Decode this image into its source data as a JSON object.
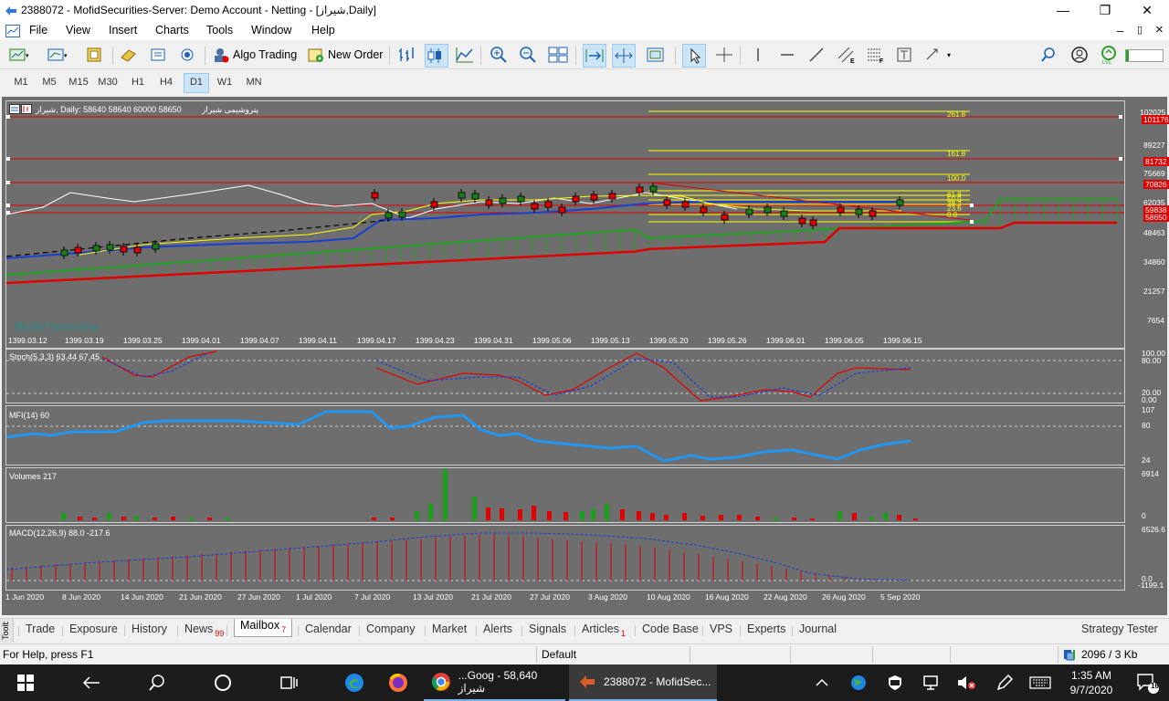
{
  "window": {
    "title": "2388072 - MofidSecurities-Server: Demo Account - Netting - [شیراز,Daily]",
    "min_btn": "—",
    "max_btn": "❐",
    "close_btn": "✕",
    "restore_btn": "▯",
    "child_min": "–",
    "child_close": "×"
  },
  "menu": [
    "File",
    "View",
    "Insert",
    "Charts",
    "Tools",
    "Window",
    "Help"
  ],
  "toolbar": {
    "algo_trading": "Algo Trading",
    "new_order": "New Order"
  },
  "timeframes": [
    "M1",
    "M5",
    "M15",
    "M30",
    "H1",
    "H4",
    "D1",
    "W1",
    "MN"
  ],
  "active_timeframe": "D1",
  "chart": {
    "header": "شیراز, Daily:  58640 58640 60000 58650",
    "symbol_desc": "پتروشیمی شیراز",
    "watermark": "Mofid Securities",
    "price_scale": [
      "102025",
      "89227",
      "75669",
      "62035",
      "48463",
      "34860",
      "21257",
      "7654"
    ],
    "price_tags": [
      {
        "label": "101176",
        "color": "#e00000"
      },
      {
        "label": "81732",
        "color": "#e00000"
      },
      {
        "label": "70826",
        "color": "#e00000"
      },
      {
        "label": "59838",
        "color": "#e00000"
      },
      {
        "label": "58650",
        "color": "#e00000"
      }
    ],
    "fib_levels": [
      "261.8",
      "161.8",
      "100.0",
      "61.8",
      "50.0",
      "38.2",
      "23.6",
      "0.0"
    ],
    "date_axis_top": [
      "1399.03.12",
      "1399.03.19",
      "1399.03.25",
      "1399.04.01",
      "1399.04.07",
      "1399.04.11",
      "1399.04.17",
      "1399.04.23",
      "1399.04.31",
      "1399.05.06",
      "1399.05.13",
      "1399.05.20",
      "1399.05.26",
      "1399.06.01",
      "1399.06.05",
      "1399.06.15"
    ],
    "date_axis_bottom": [
      "1 Jun 2020",
      "8 Jun 2020",
      "14 Jun 2020",
      "21 Jun 2020",
      "27 Jun 2020",
      "1 Jul 2020",
      "7 Jul 2020",
      "13 Jul 2020",
      "21 Jul 2020",
      "27 Jul 2020",
      "3 Aug 2020",
      "10 Aug 2020",
      "16 Aug 2020",
      "22 Aug 2020",
      "26 Aug 2020",
      "5 Sep 2020"
    ]
  },
  "indicators": {
    "stoch": {
      "label": "Stoch(5,3,3) 63.44 67.45",
      "scale": [
        "100.00",
        "80.00",
        "20.00",
        "0.00"
      ]
    },
    "mfi": {
      "label": "MFI(14) 60",
      "scale": [
        "107",
        "80",
        "24"
      ]
    },
    "volumes": {
      "label": "Volumes 217",
      "scale": [
        "6914",
        "0"
      ]
    },
    "macd": {
      "label": "MACD(12,26,9) 88.0 -217.6",
      "scale": [
        "6526.6",
        "0.0",
        "-1199.1"
      ]
    }
  },
  "tabs": [
    {
      "label": "Trade"
    },
    {
      "label": "Exposure"
    },
    {
      "label": "History"
    },
    {
      "label": "News",
      "badge": "99"
    },
    {
      "label": "Mailbox",
      "badge": "7",
      "active": true
    },
    {
      "label": "Calendar"
    },
    {
      "label": "Company"
    },
    {
      "label": "Market"
    },
    {
      "label": "Alerts"
    },
    {
      "label": "Signals"
    },
    {
      "label": "Articles",
      "badge": "1"
    },
    {
      "label": "Code Base"
    },
    {
      "label": "VPS"
    },
    {
      "label": "Experts"
    },
    {
      "label": "Journal"
    }
  ],
  "toolbox_label": "Toolbox",
  "strategy_tester": "Strategy Tester",
  "status": {
    "help": "For Help, press F1",
    "profile": "Default",
    "traffic": "2096 / 3 Kb"
  },
  "taskbar": {
    "chrome_label": "...Goog - 58,640 شیراز",
    "mt5_label": "2388072 - MofidSec...",
    "time": "1:35 AM",
    "date": "9/7/2020",
    "notif_count": "16"
  }
}
